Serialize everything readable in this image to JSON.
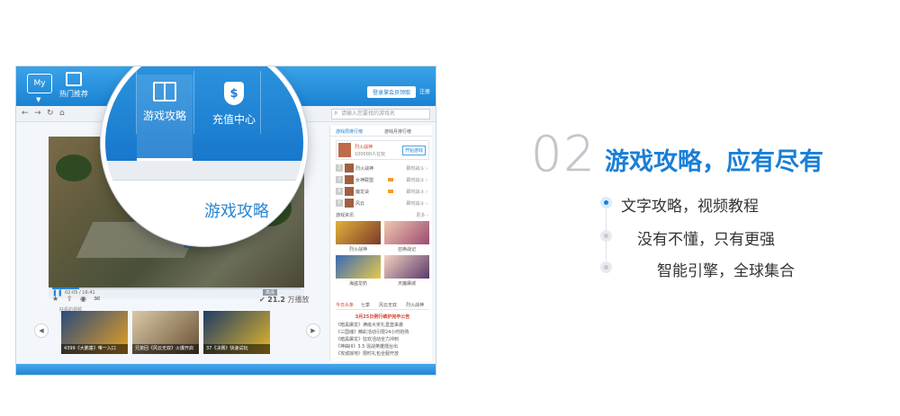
{
  "app": {
    "logo": "My",
    "nav": {
      "hot": "热门推荐"
    },
    "login_button": "登录掌会员领取",
    "register": "注册",
    "search_placeholder": "请输入您要找的游戏名",
    "video": {
      "time": "02:05 / 16:41",
      "hd": "高清",
      "like_label": "好看的视频",
      "rating": "21.2",
      "rating_unit": "万播放"
    },
    "thumbs": [
      {
        "caption": "4399《大鹏童》唯一入口"
      },
      {
        "caption": "兄弟回《风云无双》火爆开启"
      },
      {
        "caption": "37《决赛》快速试玩"
      }
    ],
    "right_panel": {
      "tabs": [
        "游戏周排行榜",
        "游戏月排行榜"
      ],
      "top": {
        "name": "烈火战神",
        "count": "100000人在玩",
        "button": "开始游戏"
      },
      "rows": [
        {
          "num": "2",
          "name": "烈火战神",
          "action": "即时战斗 ›"
        },
        {
          "num": "3",
          "name": "女神联盟",
          "action": "即时战斗 ›"
        },
        {
          "num": "4",
          "name": "魔龙诀",
          "action": "即时战斗 ›"
        },
        {
          "num": "5",
          "name": "风云",
          "action": "即时战斗 ›"
        }
      ],
      "section_title": "游戏资讯",
      "section_more": "更多 ›",
      "pics": [
        {
          "caption": "烈火战神"
        },
        {
          "caption": "召唤战记"
        },
        {
          "caption": "海盗龙奶"
        },
        {
          "caption": "天魔屠城"
        }
      ],
      "news_tabs": [
        "今日头条",
        "七季",
        "风云无双",
        "烈火战神"
      ],
      "news_headline": "3月25日例行维护完毕公告",
      "news": [
        "《暗黑屠龙》满级大奖礼盒登来袭",
        "《三国魂》精彩活动引限24小时抢购",
        "《暗黑屠龙》狂欢活动全力冲刺",
        "《神曲III》3.5 混战英雄擂台出",
        "《攻城掠地》限时礼包全服开放"
      ]
    }
  },
  "magnifier": {
    "items": [
      "游戏攻略",
      "充值中心"
    ],
    "title": "游戏攻略"
  },
  "headline": {
    "number": "02",
    "title": "游戏攻略，应有尽有"
  },
  "features": [
    "文字攻略，视频教程",
    "没有不懂，只有更强",
    "智能引擎，全球集合"
  ],
  "colors": {
    "accent": "#1a7fd6",
    "number": "#c2c6cb",
    "text": "#333333"
  }
}
